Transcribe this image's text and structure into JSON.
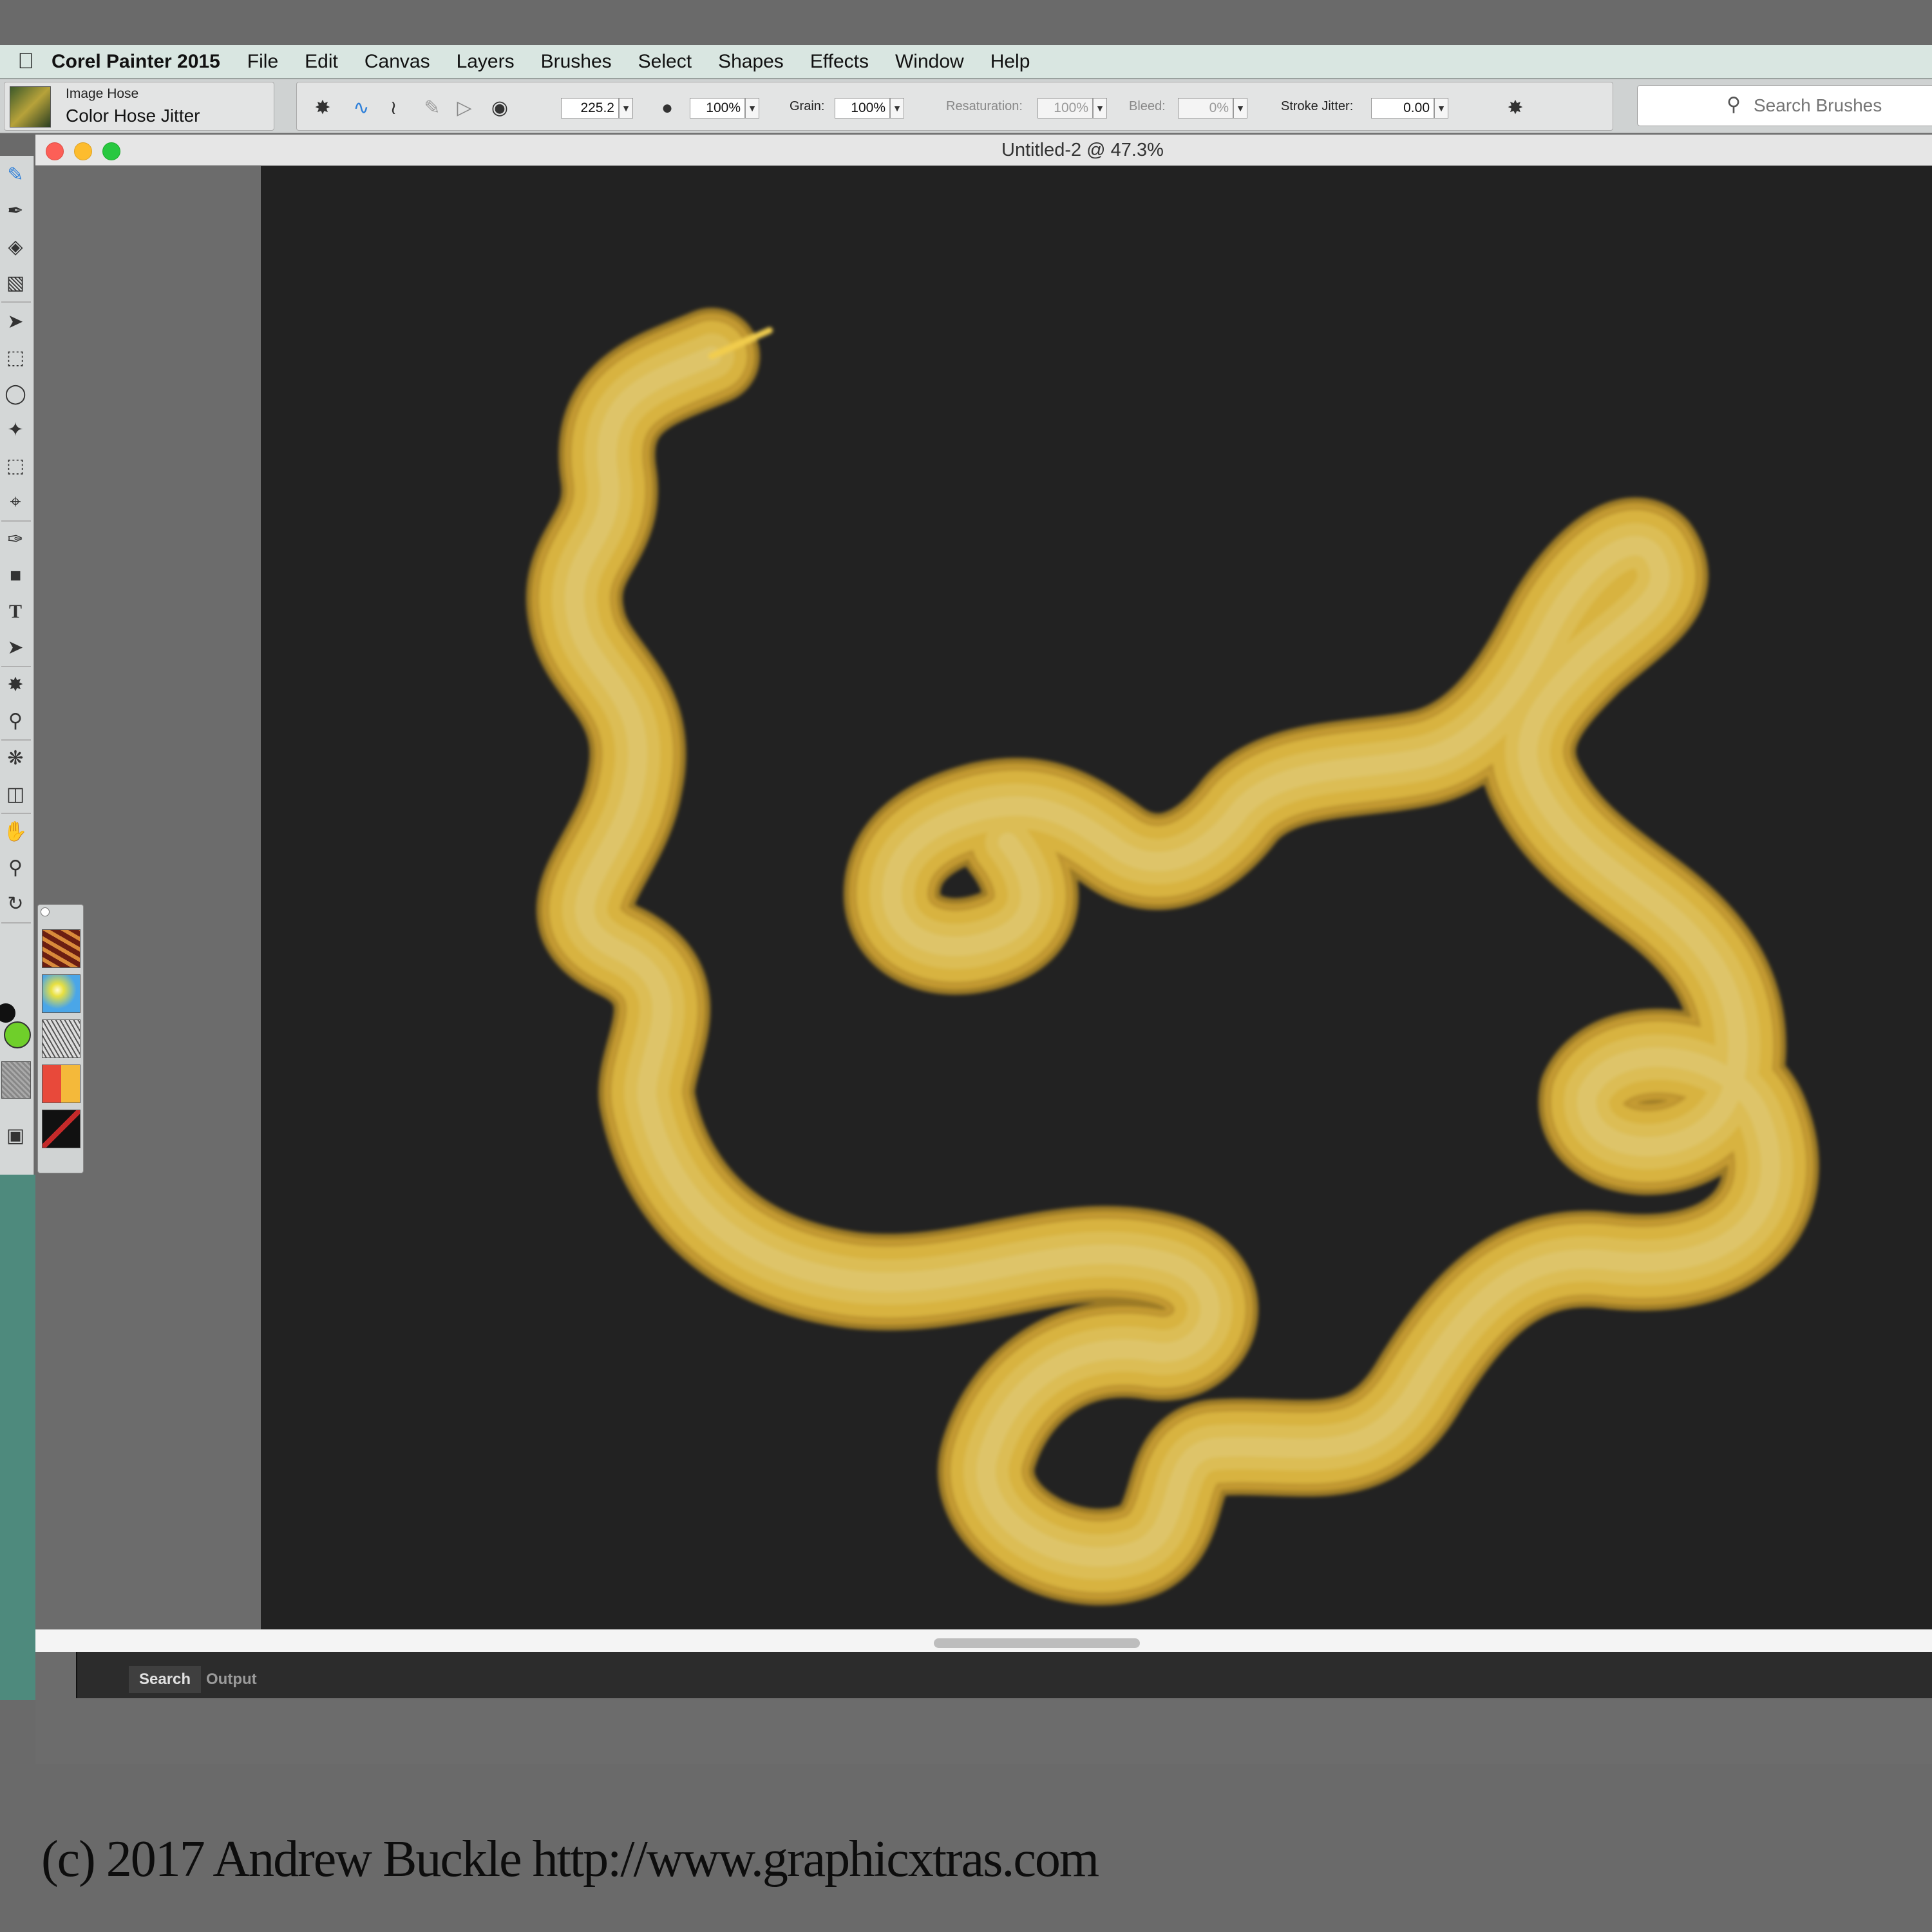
{
  "menubar": {
    "app_name": "Corel Painter 2015",
    "items": [
      "File",
      "Edit",
      "Canvas",
      "Layers",
      "Brushes",
      "Select",
      "Shapes",
      "Effects",
      "Window",
      "Help"
    ]
  },
  "brush_selector": {
    "category": "Image Hose",
    "variant": "Color Hose Jitter"
  },
  "propbar": {
    "size_value": "225.2",
    "opacity_value": "100%",
    "grain_label": "Grain:",
    "grain_value": "100%",
    "resaturation_label": "Resaturation:",
    "resaturation_value": "100%",
    "bleed_label": "Bleed:",
    "bleed_value": "0%",
    "stroke_jitter_label": "Stroke Jitter:",
    "stroke_jitter_value": "0.00"
  },
  "search": {
    "placeholder": "Search Brushes"
  },
  "document": {
    "title": "Untitled-2 @ 47.3%",
    "canvas_color": "#222222",
    "stroke_color": "#f2cd4e"
  },
  "bottom_panel": {
    "tabs": [
      "Search",
      "Output"
    ]
  },
  "colors": {
    "main_color": "#111111",
    "additional_color": "#6fcf2a"
  },
  "icons": {
    "tools": [
      "brush-icon",
      "dropper-icon",
      "paint-bucket-icon",
      "eraser-icon",
      "transform-icon",
      "rect-select-icon",
      "lasso-icon",
      "magic-wand-icon",
      "selection-adjuster-icon",
      "crop-icon",
      "pen-icon",
      "rectangle-shape-icon",
      "text-icon",
      "shape-selection-icon",
      "clone-icon",
      "dodge-icon",
      "kaleidoscope-icon",
      "mirror-icon",
      "grabber-icon",
      "magnifier-icon",
      "rotate-page-icon",
      "screen-mode-icon"
    ]
  },
  "copyright": "(c) 2017 Andrew Buckle http://www.graphicxtras.com"
}
